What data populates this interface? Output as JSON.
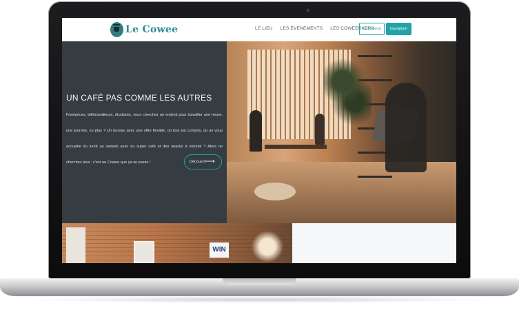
{
  "site": {
    "logo_text": "Le Cowee",
    "nav": [
      "LE LIEU",
      "LES ÉVÉNEMENTS",
      "LES COWEERKERS"
    ],
    "connexion_label": "Connexion",
    "inscription_label": "Inscription"
  },
  "hero": {
    "title": "UN CAFÉ PAS COMME LES AUTRES",
    "text": "Freelances, télétravailleurs, étudiants, vous cherchez un endroit pour travailler une heure, une journée, ou plus ? Un bureau avec une offre flexible, où tout est compris, où on vous accueille du lundi au samedi avec du super café et des snacks à volonté ? Alors ne cherchez plus : c'est au Cowee que ça se passe !",
    "button_label": "Découvrir",
    "button_icon": "arrow-right-icon"
  },
  "second_row": {
    "sign_text": "WIN"
  },
  "colors": {
    "accent": "#21a3a7",
    "logo": "#2f8d92",
    "hero_bg": "#353c42"
  }
}
